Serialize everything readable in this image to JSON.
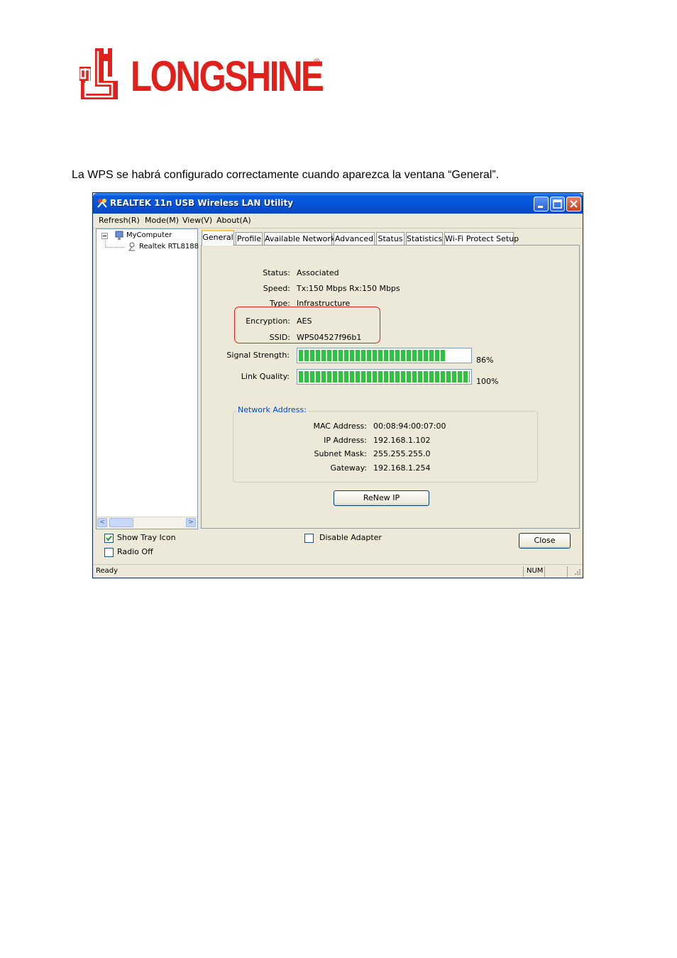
{
  "logo": {
    "text": "LONGSHINE",
    "registered": "®"
  },
  "intro_text": "La WPS se habrá configurado correctamente cuando aparezca la ventana “General”.",
  "window": {
    "title": "REALTEK 11n USB Wireless LAN Utility",
    "menu": [
      "Refresh(R)",
      "Mode(M)",
      "View(V)",
      "About(A)"
    ],
    "tree": {
      "root": "MyComputer",
      "child": "Realtek RTL8188"
    },
    "tabs": [
      "General",
      "Profile",
      "Available Network",
      "Advanced",
      "Status",
      "Statistics",
      "Wi-Fi Protect Setup"
    ],
    "active_tab": "General",
    "general": {
      "status_label": "Status:",
      "status_value": "Associated",
      "speed_label": "Speed:",
      "speed_value": "Tx:150 Mbps Rx:150 Mbps",
      "type_label": "Type:",
      "type_value": "Infrastructure",
      "encryption_label": "Encryption:",
      "encryption_value": "AES",
      "ssid_label": "SSID:",
      "ssid_value": "WPS04527f96b1",
      "signal_label": "Signal Strength:",
      "signal_text": "86%",
      "signal_percent": 86,
      "link_label": "Link Quality:",
      "link_text": "100%",
      "link_percent": 100,
      "network_group_title": "Network Address:",
      "mac_label": "MAC Address:",
      "mac_value": "00:08:94:00:07:00",
      "ip_label": "IP Address:",
      "ip_value": "192.168.1.102",
      "mask_label": "Subnet Mask:",
      "mask_value": "255.255.255.0",
      "gateway_label": "Gateway:",
      "gateway_value": "192.168.1.254",
      "renew_button": "ReNew IP"
    },
    "bottom": {
      "show_tray_icon": "Show Tray Icon",
      "show_tray_checked": true,
      "radio_off": "Radio Off",
      "radio_off_checked": false,
      "disable_adapter": "Disable Adapter",
      "disable_adapter_checked": false,
      "close_button": "Close"
    },
    "statusbar": {
      "ready": "Ready",
      "num": "NUM"
    }
  },
  "colors": {
    "brand_red": "#e0201b",
    "titlebar_blue": "#0553d6",
    "progress_green": "#2cc33c",
    "group_title_blue": "#0046d5"
  }
}
